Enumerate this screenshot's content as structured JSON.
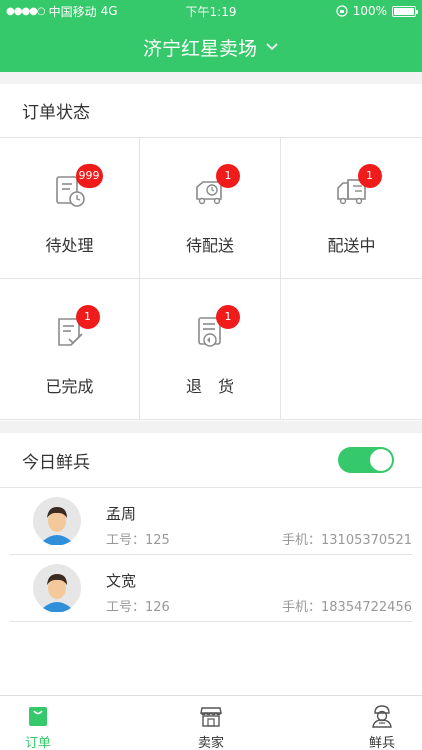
{
  "status_bar": {
    "carrier": "中国移动",
    "network": "4G",
    "time": "下午1:19",
    "battery": "100%"
  },
  "header": {
    "title": "济宁红星卖场"
  },
  "order_status": {
    "title": "订单状态",
    "items": [
      {
        "label": "待处理",
        "badge": "999",
        "icon": "pending-clock-icon"
      },
      {
        "label": "待配送",
        "badge": "1",
        "icon": "truck-clock-icon"
      },
      {
        "label": "配送中",
        "badge": "1",
        "icon": "delivery-truck-icon"
      },
      {
        "label": "已完成",
        "badge": "1",
        "icon": "completed-check-icon"
      },
      {
        "label": "退　货",
        "badge": "1",
        "icon": "return-goods-icon"
      }
    ]
  },
  "today_staff": {
    "title": "今日鲜兵",
    "toggle_on": true,
    "members": [
      {
        "name": "孟周",
        "id_label": "工号：125",
        "phone_label": "手机：13105370521"
      },
      {
        "name": "文宽",
        "id_label": "工号：126",
        "phone_label": "手机：18354722456"
      }
    ]
  },
  "tabbar": {
    "tabs": [
      {
        "label": "订单",
        "active": true
      },
      {
        "label": "卖家",
        "active": false
      },
      {
        "label": "鲜兵",
        "active": false
      }
    ]
  },
  "colors": {
    "brand_green": "#36c96b",
    "badge_red": "#f01c1c",
    "icon_gray": "#8a8a8a"
  }
}
